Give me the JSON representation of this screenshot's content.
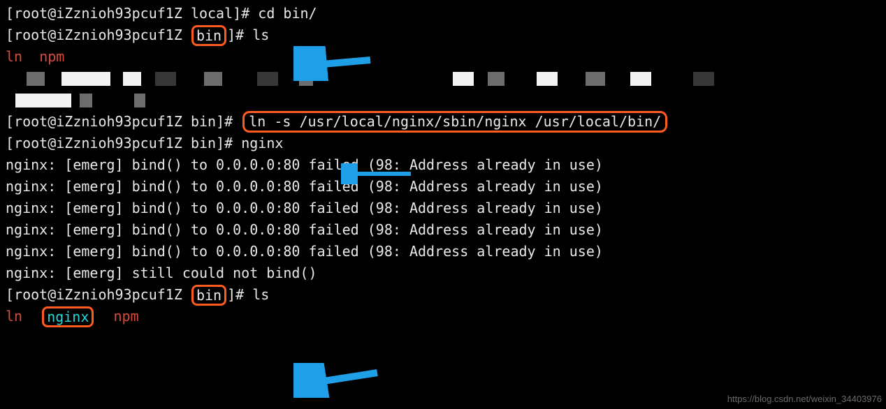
{
  "prompt": {
    "user": "root",
    "host": "iZznioh93pcuf1Z",
    "open": "[",
    "at": "@",
    "close": "]",
    "hash": "#"
  },
  "lines": {
    "l1": {
      "path": "local",
      "cmd": "cd bin/"
    },
    "l2": {
      "path": "bin",
      "cmd": "ls"
    },
    "l3": {
      "out1": "ln",
      "out2": "npm"
    },
    "l6": {
      "path": "bin",
      "cmd": "ln -s /usr/local/nginx/sbin/nginx /usr/local/bin/"
    },
    "l7": {
      "path": "bin",
      "cmd": "nginx"
    },
    "err1": "nginx: [emerg] bind() to 0.0.0.0:80 failed (98: Address already in use)",
    "err2": "nginx: [emerg] bind() to 0.0.0.0:80 failed (98: Address already in use)",
    "err3": "nginx: [emerg] bind() to 0.0.0.0:80 failed (98: Address already in use)",
    "err4": "nginx: [emerg] bind() to 0.0.0.0:80 failed (98: Address already in use)",
    "err5": "nginx: [emerg] bind() to 0.0.0.0:80 failed (98: Address already in use)",
    "err6": "nginx: [emerg] still could not bind()",
    "l14": {
      "path": "bin",
      "cmd": "ls"
    },
    "l15": {
      "out1": "ln",
      "out2": "nginx",
      "out3": "npm"
    }
  },
  "annotations": {
    "arrow_color": "#1e9fe8"
  },
  "watermark": "https://blog.csdn.net/weixin_34403976"
}
